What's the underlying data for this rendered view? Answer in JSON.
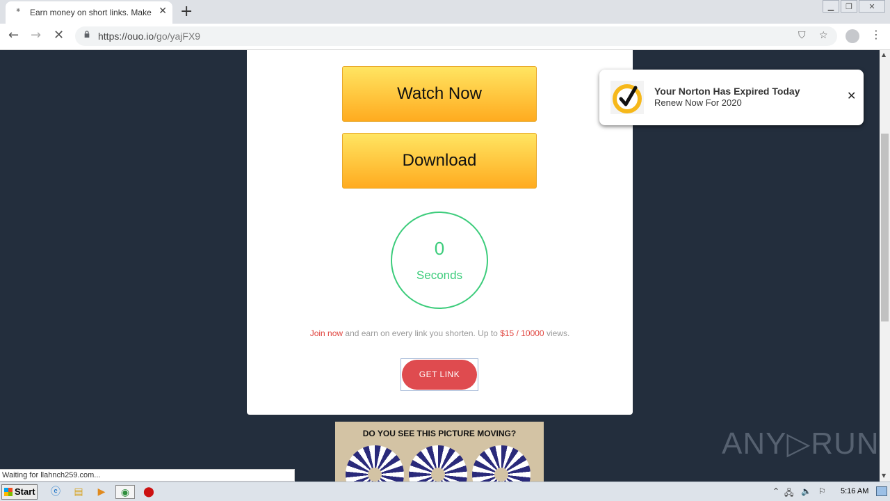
{
  "browser": {
    "tab_title": "Earn money on short links. Make sho",
    "tab_favicon": "loading-spinner",
    "new_tab": "+",
    "url_host": "https://ouo.io",
    "url_path": "/go/yajFX9",
    "window_controls": [
      "minimize",
      "restore",
      "close"
    ]
  },
  "page": {
    "watch_now_label": "Watch Now",
    "download_label": "Download",
    "countdown_value": "0",
    "countdown_unit": "Seconds",
    "promo": {
      "join": "Join now",
      "middle": " and earn on every link you shorten. Up to ",
      "rate": "$15 / 10000",
      "end": " views."
    },
    "get_link_label": "GET LINK",
    "ad_headline": "DO YOU SEE THIS PICTURE MOVING?"
  },
  "popup": {
    "title": "Your Norton Has Expired Today",
    "subtitle": "Renew Now For 2020",
    "close": "✕"
  },
  "status_text": "Waiting for llahnch259.com...",
  "watermark": "ANY▷RUN",
  "taskbar": {
    "start_label": "Start",
    "clock": "5:16 AM"
  },
  "colors": {
    "page_bg": "#232e3d",
    "button_gold": "#ffc73a",
    "timer_green": "#3ccc7b",
    "accent_red": "#df4b4f"
  }
}
